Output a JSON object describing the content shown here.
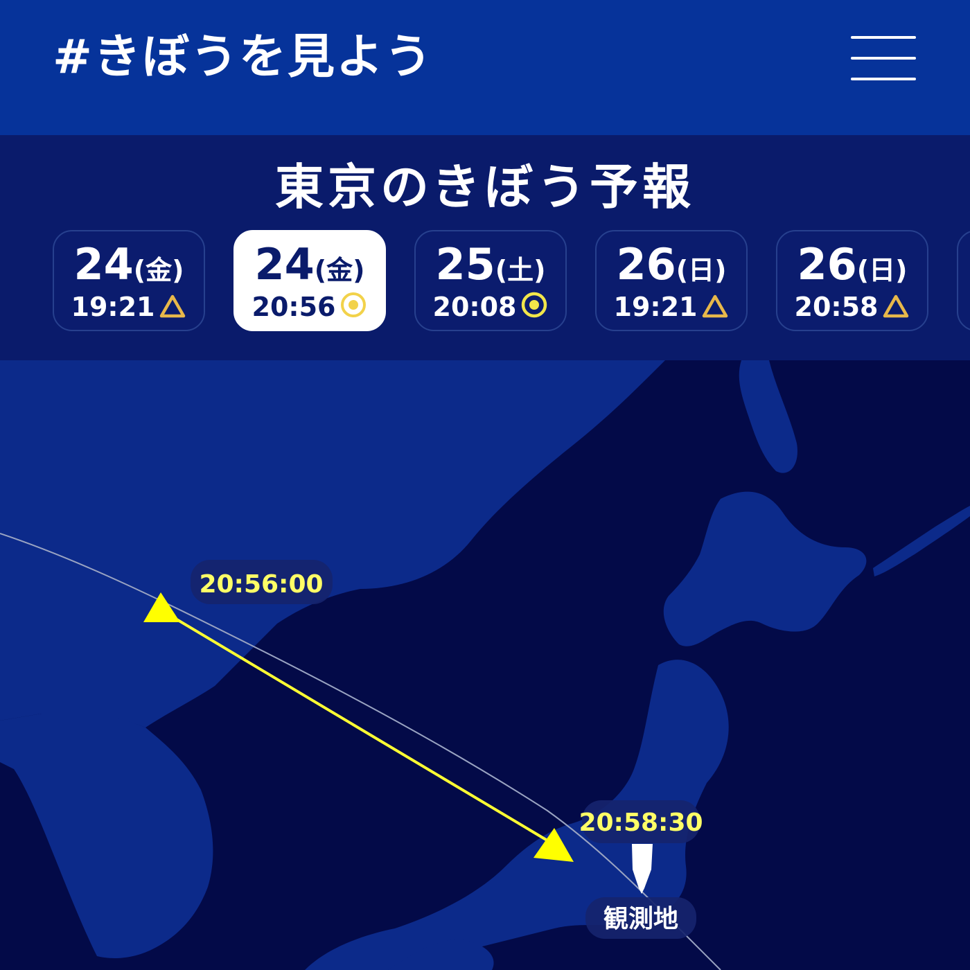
{
  "header": {
    "brand": "#きぼうを見よう",
    "menu_icon": "hamburger-menu-icon"
  },
  "forecast": {
    "title": "東京のきぼう予報",
    "tabs": [
      {
        "date": "24",
        "day": "(金)",
        "time": "19:21",
        "status": "triangle",
        "selected": false
      },
      {
        "date": "24",
        "day": "(金)",
        "time": "20:56",
        "status": "double-circle",
        "selected": true
      },
      {
        "date": "25",
        "day": "(土)",
        "time": "20:08",
        "status": "double-circle",
        "selected": false
      },
      {
        "date": "26",
        "day": "(日)",
        "time": "19:21",
        "status": "triangle",
        "selected": false
      },
      {
        "date": "26",
        "day": "(日)",
        "time": "20:58",
        "status": "triangle",
        "selected": false
      }
    ]
  },
  "map": {
    "start_time": "20:56:00",
    "end_time": "20:58:30",
    "observer_label": "観測地"
  },
  "colors": {
    "header_bg": "#06339a",
    "forecast_bg": "#0a1b6b",
    "sea": "#030a48",
    "land": "#0c2a8a",
    "path": "#ffff00",
    "icon_accent": "#e8b84a"
  }
}
